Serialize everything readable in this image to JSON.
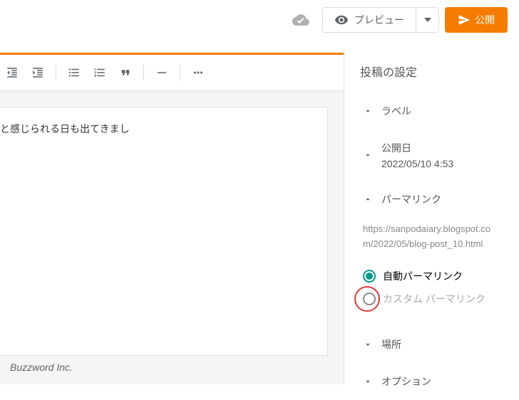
{
  "topbar": {
    "preview_label": "プレビュー",
    "publish_label": "公開"
  },
  "editor": {
    "content_text": "と感じられる日も出てきまし"
  },
  "footer": {
    "copyright": "Buzzword Inc."
  },
  "sidebar": {
    "section_title": "投稿の設定",
    "labels": {
      "title": "ラベル"
    },
    "published": {
      "title": "公開日",
      "datetime": "2022/05/10 4:53"
    },
    "permalink": {
      "title": "パーマリンク",
      "url": "https://sanpodaiary.blogspot.com/2022/05/blog-post_10.html",
      "auto_label": "自動パーマリンク",
      "custom_label": "カスタム パーマリンク"
    },
    "location": {
      "title": "場所"
    },
    "options": {
      "title": "オプション"
    }
  }
}
